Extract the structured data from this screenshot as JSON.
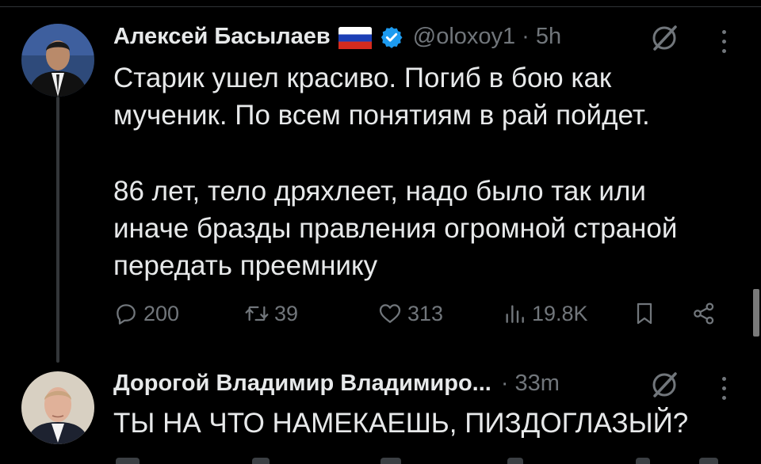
{
  "tweets": [
    {
      "name": "Алексей Басылаев",
      "flag": "russia-flag-icon",
      "handle": "@oloxoy1",
      "separator": "·",
      "time": "5h",
      "text_lines": [
        "Старик ушел красиво. Погиб в бою как",
        "мученик. По всем понятиям в рай пойдет.",
        "",
        "86 лет, тело дряхлеет, надо было так или",
        "иначе бразды правления огромной страной",
        "передать преемнику"
      ],
      "actions": {
        "replies": "200",
        "reposts": "39",
        "likes": "313",
        "views": "19.8K"
      }
    },
    {
      "name": "Дорогой Владимир Владимиро...",
      "separator": "·",
      "time": "33m",
      "text": "ТЫ НА ЧТО НАМЕКАЕШЬ, ПИЗДОГЛАЗЫЙ?"
    }
  ],
  "colors": {
    "background": "#000000",
    "text": "#e7e9ea",
    "muted": "#71767b",
    "verified": "#1d9bf0"
  }
}
